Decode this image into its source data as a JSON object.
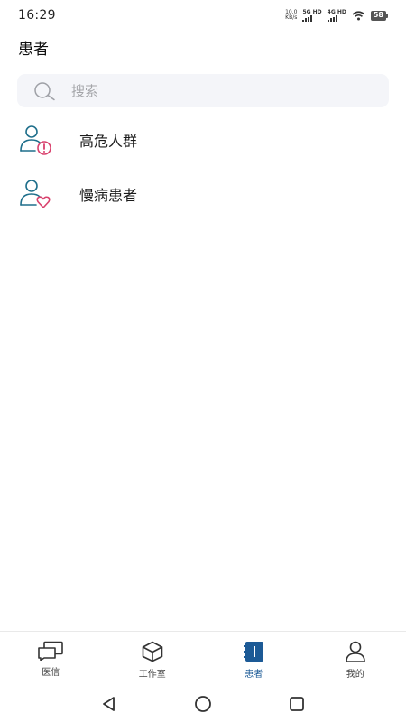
{
  "status_bar": {
    "time": "16:29",
    "net_speed_value": "10.0",
    "net_speed_unit": "KB/s",
    "sim1_label": "5G HD",
    "sim2_label": "4G HD",
    "battery": "58"
  },
  "header": {
    "title": "患者"
  },
  "search": {
    "placeholder": "搜索",
    "icon": "search-icon"
  },
  "list": [
    {
      "label": "高危人群",
      "icon": "user-alert-icon",
      "accent": "#d9416d"
    },
    {
      "label": "慢病患者",
      "icon": "user-heart-icon",
      "accent": "#d9416d"
    }
  ],
  "tabbar": {
    "active_color": "#1c5a96",
    "tabs": [
      {
        "label": "医信",
        "icon": "chat-icon"
      },
      {
        "label": "工作室",
        "icon": "cube-icon"
      },
      {
        "label": "患者",
        "icon": "notebook-icon",
        "active": true
      },
      {
        "label": "我的",
        "icon": "person-icon"
      }
    ]
  },
  "system_nav": {
    "back": "back-icon",
    "home": "home-icon",
    "recents": "recents-icon"
  },
  "colors": {
    "primary": "#1c5a96",
    "icon_teal": "#1f6f8b",
    "icon_pink": "#d9416d"
  }
}
